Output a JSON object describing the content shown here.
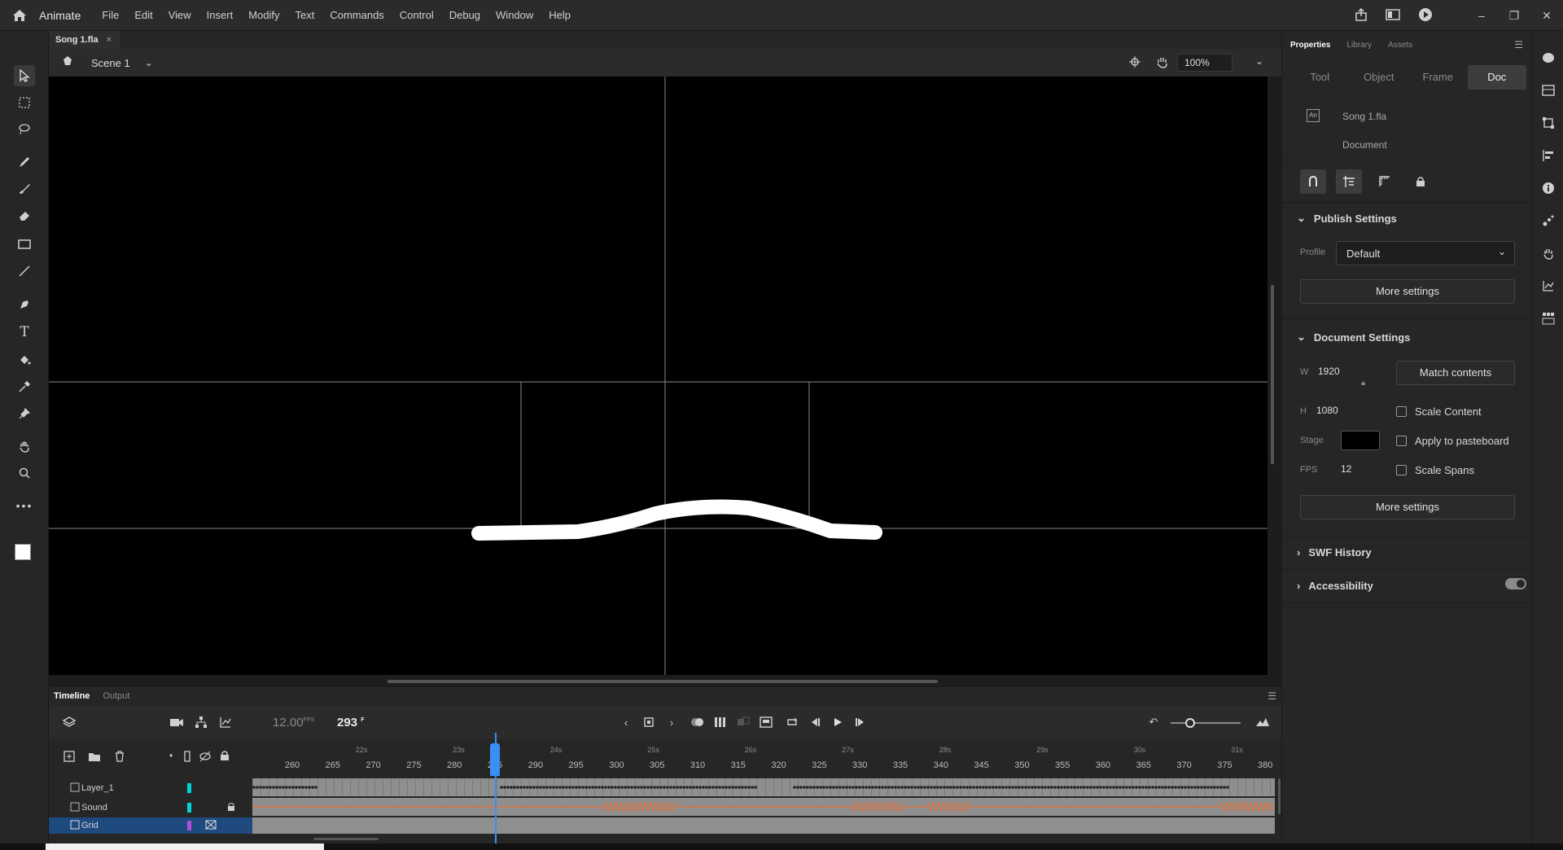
{
  "menubar": {
    "app_name": "Animate",
    "menus": [
      "File",
      "Edit",
      "View",
      "Insert",
      "Modify",
      "Text",
      "Commands",
      "Control",
      "Debug",
      "Window",
      "Help"
    ]
  },
  "document": {
    "tab_label": "Song 1.fla",
    "close_label": "×"
  },
  "scene": {
    "label": "Scene 1",
    "zoom": "100%"
  },
  "timeline": {
    "tabs": [
      "Timeline",
      "Output"
    ],
    "fps": "12.00",
    "fps_unit": "FPS",
    "current_frame": "293",
    "frame_unit": "F",
    "frame_ticks": [
      "260",
      "265",
      "270",
      "275",
      "280",
      "285",
      "290",
      "295",
      "300",
      "305",
      "310",
      "315",
      "320",
      "325",
      "330",
      "335",
      "340",
      "345",
      "350",
      "355",
      "360",
      "365",
      "370",
      "375",
      "380"
    ],
    "second_marks": [
      "22s",
      "23s",
      "24s",
      "25s",
      "26s",
      "27s",
      "28s",
      "29s",
      "30s",
      "31s"
    ],
    "layers": [
      {
        "name": "Layer_1",
        "color": "#00d4d4"
      },
      {
        "name": "Sound",
        "color": "#00d4d4"
      },
      {
        "name": "Grid",
        "color": "#b04fd8"
      }
    ]
  },
  "properties": {
    "tabs": [
      "Properties",
      "Library",
      "Assets"
    ],
    "segments": [
      "Tool",
      "Object",
      "Frame",
      "Doc"
    ],
    "active_segment": "Doc",
    "file_name": "Song 1.fla",
    "file_kind": "Document",
    "publish_settings": {
      "title": "Publish Settings",
      "profile_label": "Profile",
      "profile_value": "Default",
      "more_settings": "More settings"
    },
    "document_settings": {
      "title": "Document Settings",
      "w_label": "W",
      "w_value": "1920",
      "h_label": "H",
      "h_value": "1080",
      "match_contents": "Match contents",
      "stage_label": "Stage",
      "stage_color": "#000000",
      "fps_label": "FPS",
      "fps_value": "12",
      "scale_content": "Scale Content",
      "apply_pasteboard": "Apply to pasteboard",
      "scale_spans": "Scale Spans",
      "more_settings": "More settings"
    },
    "swf_history": "SWF History",
    "accessibility": "Accessibility"
  },
  "colors": {
    "accent": "#3a8ef5",
    "sound_wave": "#e0703a",
    "layer_select": "#1f4a80"
  }
}
